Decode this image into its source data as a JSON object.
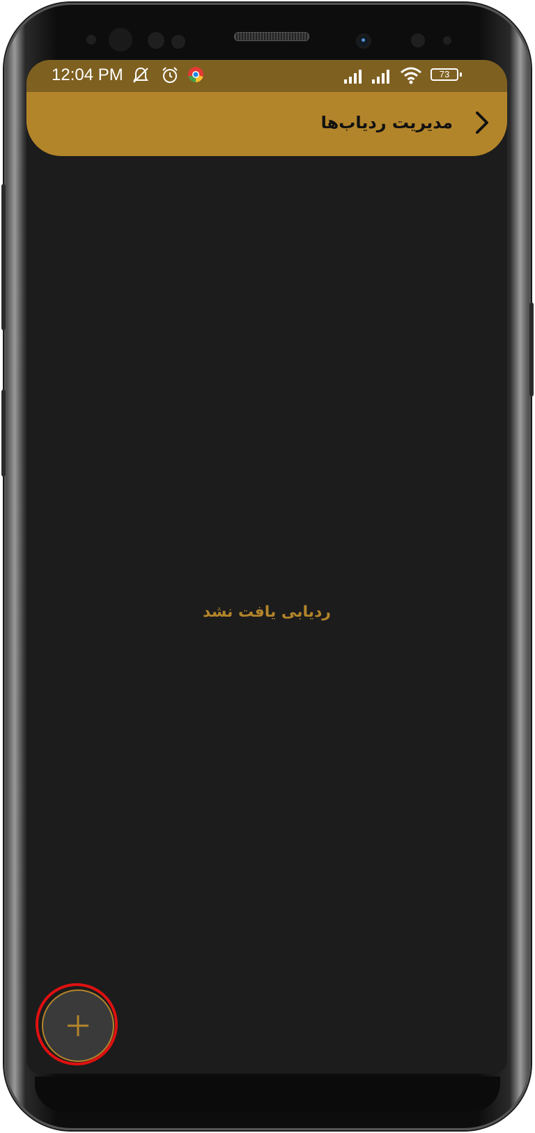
{
  "status_bar": {
    "time": "12:04 PM",
    "battery": "73",
    "icons": [
      "notifications-muted-icon",
      "alarm-icon",
      "chrome-icon",
      "signal-icon",
      "signal-icon",
      "wifi-icon",
      "battery-icon"
    ]
  },
  "toolbar": {
    "title": "مدیریت ردیاب‌ها",
    "back_icon": "chevron-right-icon"
  },
  "content": {
    "empty_message": "ردیابی یافت نشد"
  },
  "fab": {
    "icon": "plus-icon"
  },
  "colors": {
    "accent": "#b3852b",
    "status_bar": "#7e6021",
    "background": "#1c1c1c",
    "highlight": "#e01010"
  }
}
